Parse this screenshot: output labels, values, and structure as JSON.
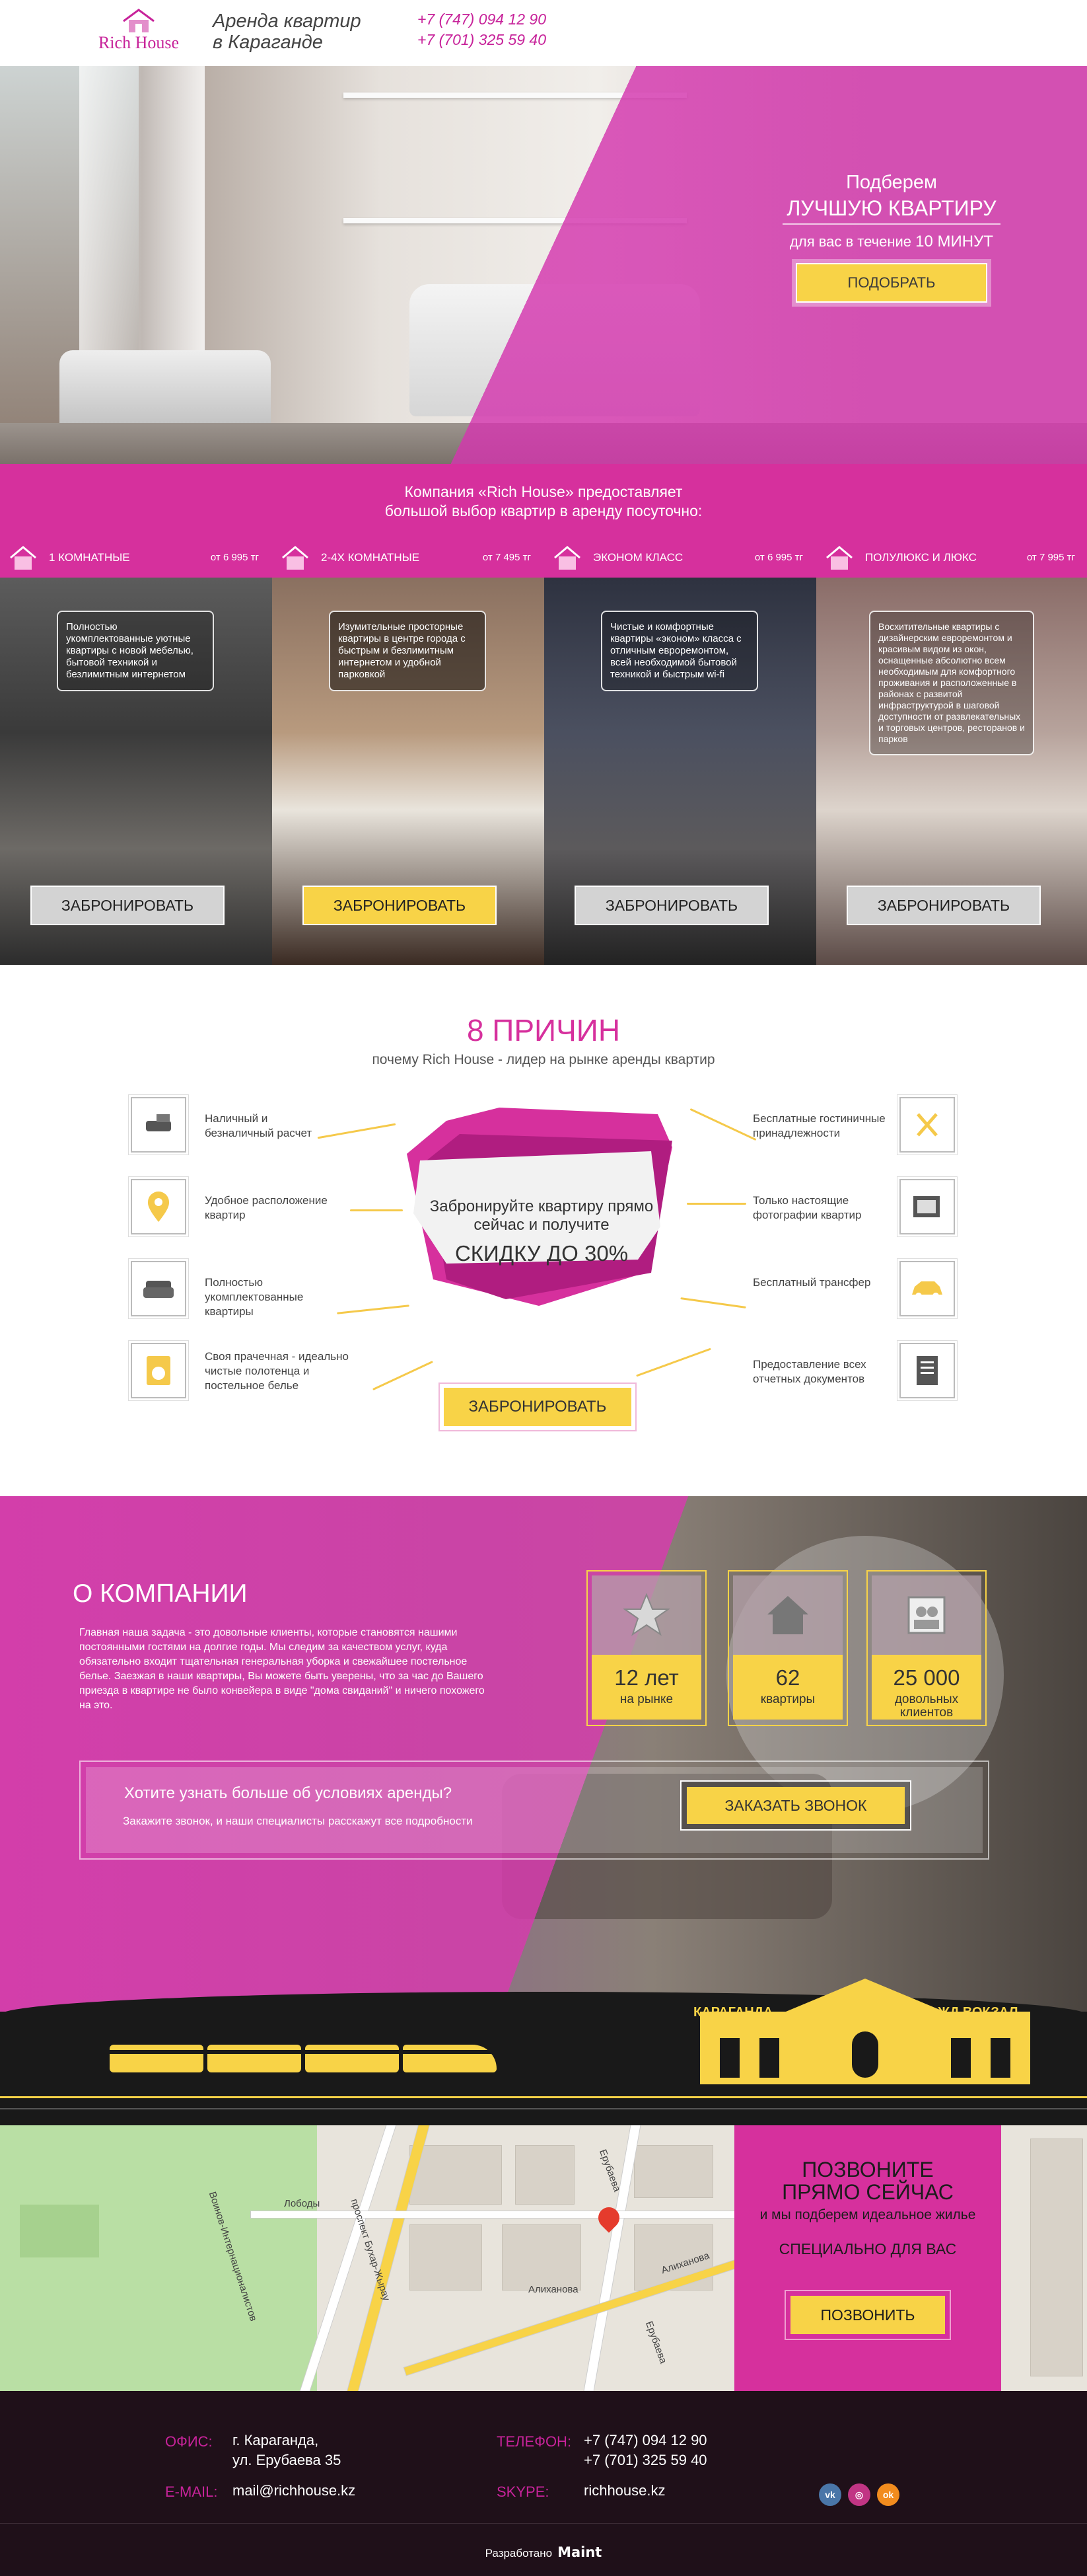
{
  "header": {
    "logo_text": "Rich House",
    "tagline_1": "Аренда квартир",
    "tagline_2": "в Караганде",
    "phone_1": "+7 (747) 094 12 90",
    "phone_2": "+7 (701) 325 59 40"
  },
  "hero": {
    "line1": "Подберем",
    "line2": "ЛУЧШУЮ КВАРТИРУ",
    "line3_a": "для вас в течение",
    "line3_b": "10 МИНУТ",
    "button": "ПОДОБРАТЬ"
  },
  "intro": {
    "line1": "Компания «Rich House» предоставляет",
    "line2": "большой выбор квартир в аренду посуточно:"
  },
  "cards": [
    {
      "title": "1 КОМНАТНЫЕ",
      "price": "от 6 995 тг",
      "desc": "Полностью укомплектованные уютные квартиры с новой мебелью, бытовой техникой и безлимитным интернетом",
      "button": "ЗАБРОНИРОВАТЬ"
    },
    {
      "title": "2-4Х КОМНАТНЫЕ",
      "price": "от 7 495 тг",
      "desc": "Изумительные просторные квартиры в центре города с быстрым и безлимитным интернетом и удобной парковкой",
      "button": "ЗАБРОНИРОВАТЬ"
    },
    {
      "title": "ЭКОНОМ КЛАСС",
      "price": "от 6 995 тг",
      "desc": "Чистые и комфортные квартиры «эконом» класса с отличным евроремонтом, всей необходимой бытовой техникой и быстрым wi-fi",
      "button": "ЗАБРОНИРОВАТЬ"
    },
    {
      "title": "ПОЛУЛЮКС И ЛЮКС",
      "price": "от 7 995 тг",
      "desc": "Восхитительные квартиры с дизайнерским евроремонтом и красивым видом из окон, оснащенные абсолютно всем необходимым для комфортного проживания и расположенные в районах с развитой инфраструктурой в шаговой доступности от развлекательных и торговых центров, ресторанов и парков",
      "button": "ЗАБРОНИРОВАТЬ"
    }
  ],
  "reasons": {
    "title": "8 ПРИЧИН",
    "subtitle": "почему Rich House - лидер на рынке аренды квартир",
    "left": [
      {
        "icon": "cash-hand-icon",
        "text": "Наличный и безналичный расчет"
      },
      {
        "icon": "location-pin-icon",
        "text": "Удобное расположение квартир"
      },
      {
        "icon": "armchair-icon",
        "text": "Полностью укомплектованные квартиры"
      },
      {
        "icon": "washing-machine-icon",
        "text": "Своя прачечная - идеально чистые полотенца и постельное белье"
      }
    ],
    "right": [
      {
        "icon": "fork-spoon-icon",
        "text": "Бесплатные гостиничные принадлежности"
      },
      {
        "icon": "photo-icon",
        "text": "Только настоящие фотографии квартир"
      },
      {
        "icon": "car-icon",
        "text": "Бесплатный трансфер"
      },
      {
        "icon": "document-icon",
        "text": "Предоставление всех отчетных документов"
      }
    ],
    "ribbon_1": "Забронируйте квартиру прямо",
    "ribbon_2": "сейчас и получите",
    "ribbon_3": "СКИДКУ ДО 30%",
    "button": "ЗАБРОНИРОВАТЬ"
  },
  "about": {
    "title": "О КОМПАНИИ",
    "text": "Главная наша задача - это довольные клиенты, которые становятся нашими постоянными гостями на долгие годы. Мы следим за качеством услуг, куда обязательно входит тщательная генеральная уборка и свежайшее постельное белье. Заезжая в наши квартиры, Вы можете быть уверены, что за час до Вашего приезда в квартире не было конвейера в виде \"дома свиданий\" и ничего похожего на это.",
    "stats": [
      {
        "icon": "star-icon",
        "num": "12 лет",
        "label": "на рынке"
      },
      {
        "icon": "house-icon",
        "num": "62",
        "label": "квартиры"
      },
      {
        "icon": "clients-icon",
        "num": "25 000",
        "label": "довольных клиентов"
      }
    ],
    "question": "Хотите узнать больше об условиях аренды?",
    "question_sub": "Закажите звонок, и наши специалисты расскажут все подробности",
    "call_button": "ЗАКАЗАТЬ ЗВОНОК"
  },
  "station": {
    "left": "КАРАГАНДА",
    "right": "ЖД ВОКЗАЛ"
  },
  "map": {
    "labels": [
      "Лободы",
      "Ерубаева",
      "Алиханова",
      "Алиханова",
      "проспект Бухар-Жырау",
      "Воинов-Интернационалистов",
      "Ерубаева"
    ]
  },
  "call": {
    "title_1": "ПОЗВОНИТЕ",
    "title_2": "ПРЯМО СЕЙЧАС",
    "sub": "и мы подберем идеальное жилье",
    "special": "СПЕЦИАЛЬНО ДЛЯ ВАС",
    "button": "ПОЗВОНИТЬ"
  },
  "footer": {
    "office_label": "ОФИС:",
    "office_1": "г. Караганда,",
    "office_2": "ул. Ерубаева 35",
    "phone_label": "ТЕЛЕФОН:",
    "phone_1": "+7 (747) 094 12 90",
    "phone_2": "+7 (701) 325 59 40",
    "email_label": "E-MAIL:",
    "email": "mail@richhouse.kz",
    "skype_label": "SKYPE:",
    "skype": "richhouse.kz",
    "dev_label": "Разработано",
    "dev_name": "Maint",
    "social": [
      "vk-icon",
      "instagram-icon",
      "odnoklassniki-icon"
    ]
  },
  "colors": {
    "accent": "#d6309d",
    "gold": "#f8d347",
    "dark": "#1f1019"
  }
}
